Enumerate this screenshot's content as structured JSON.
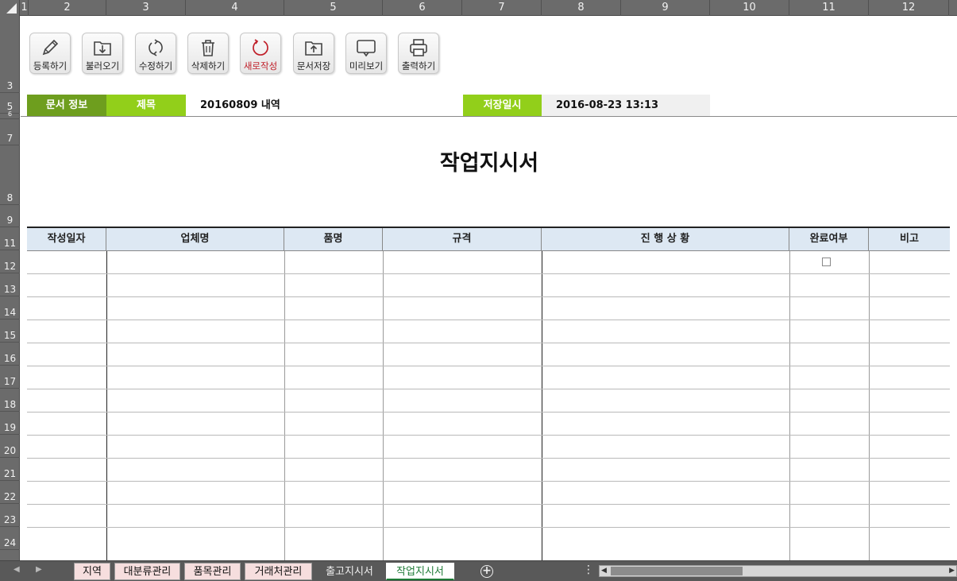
{
  "columns": [
    "1",
    "2",
    "3",
    "4",
    "5",
    "6",
    "7",
    "8",
    "9",
    "10",
    "11",
    "12"
  ],
  "rows": [
    "3",
    "5",
    "6",
    "7",
    "8",
    "9",
    "11",
    "12",
    "13",
    "14",
    "15",
    "16",
    "17",
    "18",
    "19",
    "20",
    "21",
    "22",
    "23",
    "24"
  ],
  "toolbar": [
    {
      "label": "등록하기",
      "icon": "pencil-icon"
    },
    {
      "label": "불러오기",
      "icon": "folder-download-icon"
    },
    {
      "label": "수정하기",
      "icon": "refresh-icon"
    },
    {
      "label": "삭제하기",
      "icon": "trash-icon"
    },
    {
      "label": "새로작성",
      "icon": "new-circle-icon"
    },
    {
      "label": "문서저장",
      "icon": "folder-upload-icon"
    },
    {
      "label": "미리보기",
      "icon": "monitor-icon"
    },
    {
      "label": "출력하기",
      "icon": "printer-icon"
    }
  ],
  "info": {
    "section_label": "문서 정보",
    "title_label": "제목",
    "title_value": "20160809 내역",
    "saved_label": "저장일시",
    "saved_value": "2016-08-23 13:13"
  },
  "document_title": "작업지시서",
  "table": {
    "headers": [
      "작성일자",
      "업체명",
      "품명",
      "규격",
      "진 행 상 황",
      "완료여부",
      "비고"
    ],
    "visible_rows": 13,
    "first_row_checkbox_checked": false
  },
  "sheets": {
    "tabs": [
      "지역",
      "대분류관리",
      "품목관리",
      "거래처관리",
      "출고지시서",
      "작업지시서"
    ],
    "active": "작업지시서"
  },
  "colors": {
    "section_green": "#6e9e1e",
    "label_lime": "#92cf1a",
    "header_blue": "#dde8f3",
    "active_tab_green": "#1e7a36"
  }
}
